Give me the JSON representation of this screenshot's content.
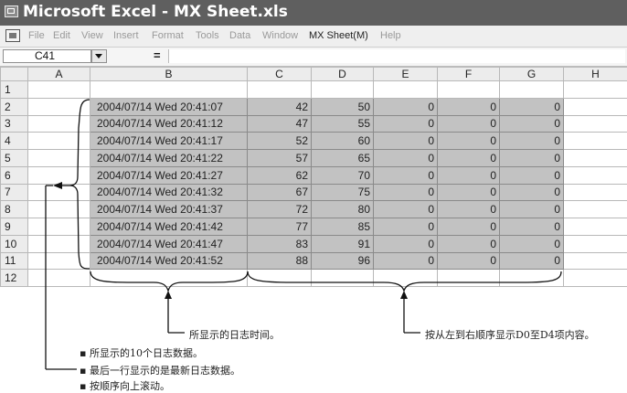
{
  "window": {
    "title": "Microsoft Excel - MX Sheet.xls"
  },
  "menu": [
    "File",
    "Edit",
    "View",
    "Insert",
    "Format",
    "Tools",
    "Data",
    "Window",
    "MX Sheet(M)",
    "Help"
  ],
  "formula_bar": {
    "cell_ref": "C41",
    "fx": "=",
    "value": ""
  },
  "columns": [
    "A",
    "B",
    "C",
    "D",
    "E",
    "F",
    "G",
    "H"
  ],
  "rows": [
    {
      "n": "1",
      "cells": null
    },
    {
      "n": "2",
      "cells": [
        "2004/07/14 Wed 20:41:07",
        "42",
        "50",
        "0",
        "0",
        "0"
      ]
    },
    {
      "n": "3",
      "cells": [
        "2004/07/14 Wed 20:41:12",
        "47",
        "55",
        "0",
        "0",
        "0"
      ]
    },
    {
      "n": "4",
      "cells": [
        "2004/07/14 Wed 20:41:17",
        "52",
        "60",
        "0",
        "0",
        "0"
      ]
    },
    {
      "n": "5",
      "cells": [
        "2004/07/14 Wed 20:41:22",
        "57",
        "65",
        "0",
        "0",
        "0"
      ]
    },
    {
      "n": "6",
      "cells": [
        "2004/07/14 Wed 20:41:27",
        "62",
        "70",
        "0",
        "0",
        "0"
      ]
    },
    {
      "n": "7",
      "cells": [
        "2004/07/14 Wed 20:41:32",
        "67",
        "75",
        "0",
        "0",
        "0"
      ]
    },
    {
      "n": "8",
      "cells": [
        "2004/07/14 Wed 20:41:37",
        "72",
        "80",
        "0",
        "0",
        "0"
      ]
    },
    {
      "n": "9",
      "cells": [
        "2004/07/14 Wed 20:41:42",
        "77",
        "85",
        "0",
        "0",
        "0"
      ]
    },
    {
      "n": "10",
      "cells": [
        "2004/07/14 Wed 20:41:47",
        "83",
        "91",
        "0",
        "0",
        "0"
      ]
    },
    {
      "n": "11",
      "cells": [
        "2004/07/14 Wed 20:41:52",
        "88",
        "96",
        "0",
        "0",
        "0"
      ]
    },
    {
      "n": "12",
      "cells": null
    }
  ],
  "annotations": {
    "time_label": "所显示的日志时间。",
    "data_label": "按从左到右顺序显示D0至D4项内容。",
    "bullets": [
      "所显示的10个日志数据。",
      "最后一行显示的是最新日志数据。",
      "按顺序向上滚动。"
    ],
    "bullet_char": "▪"
  }
}
